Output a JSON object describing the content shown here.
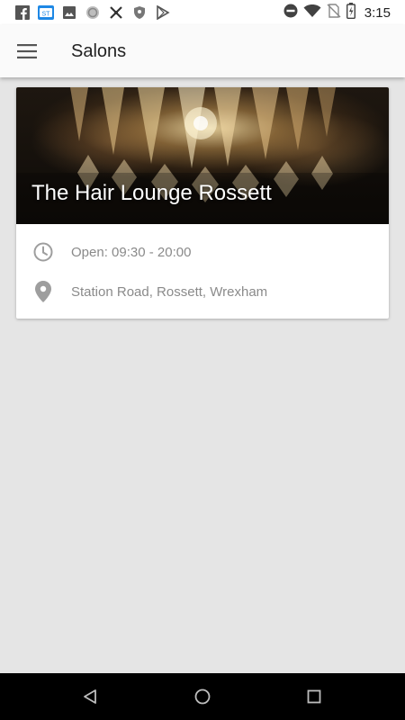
{
  "status_bar": {
    "time": "3:15",
    "left_icons": [
      "facebook-icon",
      "app-store-icon",
      "image-icon",
      "circle-icon",
      "no-signal-icon",
      "shield-icon",
      "play-store-icon"
    ],
    "right_icons": [
      "do-not-disturb-icon",
      "wifi-icon",
      "no-sim-icon",
      "battery-charging-icon"
    ]
  },
  "app_bar": {
    "title": "Salons",
    "menu_icon": "hamburger-menu-icon"
  },
  "salon_card": {
    "name": "The Hair Lounge Rossett",
    "hours": "Open: 09:30 - 20:00",
    "address": "Station Road, Rossett, Wrexham",
    "hours_icon": "clock-icon",
    "address_icon": "location-pin-icon"
  },
  "nav_bar": {
    "buttons": [
      "back-icon",
      "home-icon",
      "recents-icon"
    ]
  }
}
